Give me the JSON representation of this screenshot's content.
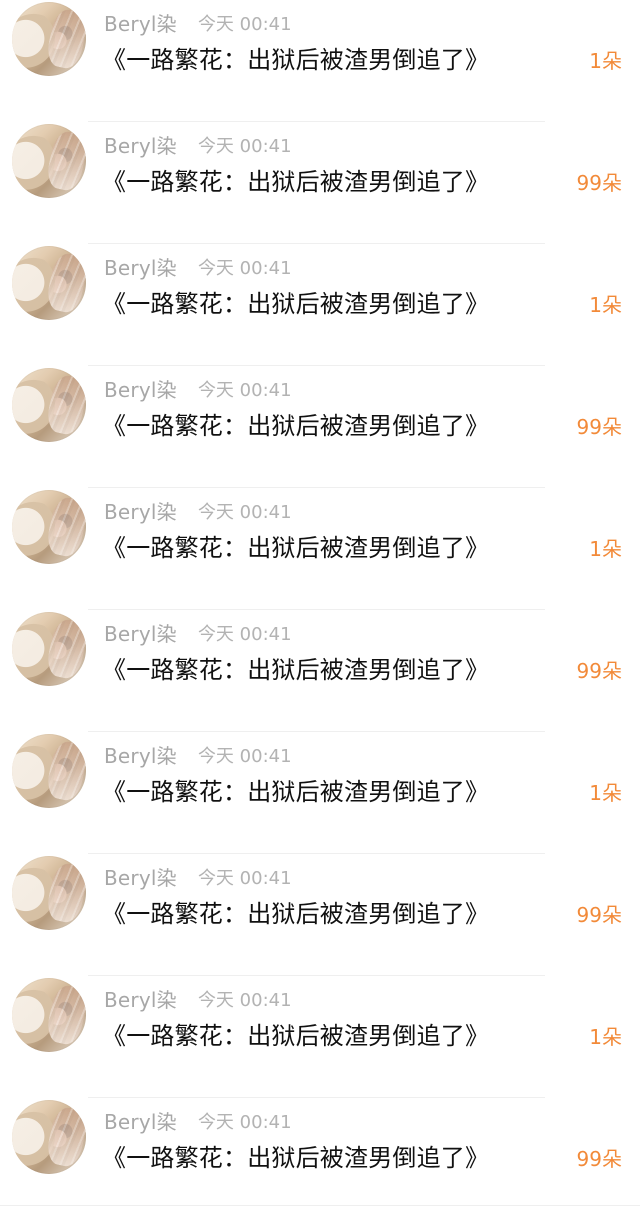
{
  "items": [
    {
      "username": "Beryl染",
      "time": "今天 00:41",
      "message": "《一路繁花：出狱后被渣男倒追了》",
      "amount": "1朵"
    },
    {
      "username": "Beryl染",
      "time": "今天 00:41",
      "message": "《一路繁花：出狱后被渣男倒追了》",
      "amount": "99朵"
    },
    {
      "username": "Beryl染",
      "time": "今天 00:41",
      "message": "《一路繁花：出狱后被渣男倒追了》",
      "amount": "1朵"
    },
    {
      "username": "Beryl染",
      "time": "今天 00:41",
      "message": "《一路繁花：出狱后被渣男倒追了》",
      "amount": "99朵"
    },
    {
      "username": "Beryl染",
      "time": "今天 00:41",
      "message": "《一路繁花：出狱后被渣男倒追了》",
      "amount": "1朵"
    },
    {
      "username": "Beryl染",
      "time": "今天 00:41",
      "message": "《一路繁花：出狱后被渣男倒追了》",
      "amount": "99朵"
    },
    {
      "username": "Beryl染",
      "time": "今天 00:41",
      "message": "《一路繁花：出狱后被渣男倒追了》",
      "amount": "1朵"
    },
    {
      "username": "Beryl染",
      "time": "今天 00:41",
      "message": "《一路繁花：出狱后被渣男倒追了》",
      "amount": "99朵"
    },
    {
      "username": "Beryl染",
      "time": "今天 00:41",
      "message": "《一路繁花：出狱后被渣男倒追了》",
      "amount": "1朵"
    },
    {
      "username": "Beryl染",
      "time": "今天 00:41",
      "message": "《一路繁花：出狱后被渣男倒追了》",
      "amount": "99朵"
    }
  ],
  "colors": {
    "background": "#ffffff",
    "username": "#a7a7a7",
    "timestamp": "#b3b3b3",
    "message": "#111111",
    "amount": "#f28a39",
    "divider": "#efefef"
  }
}
